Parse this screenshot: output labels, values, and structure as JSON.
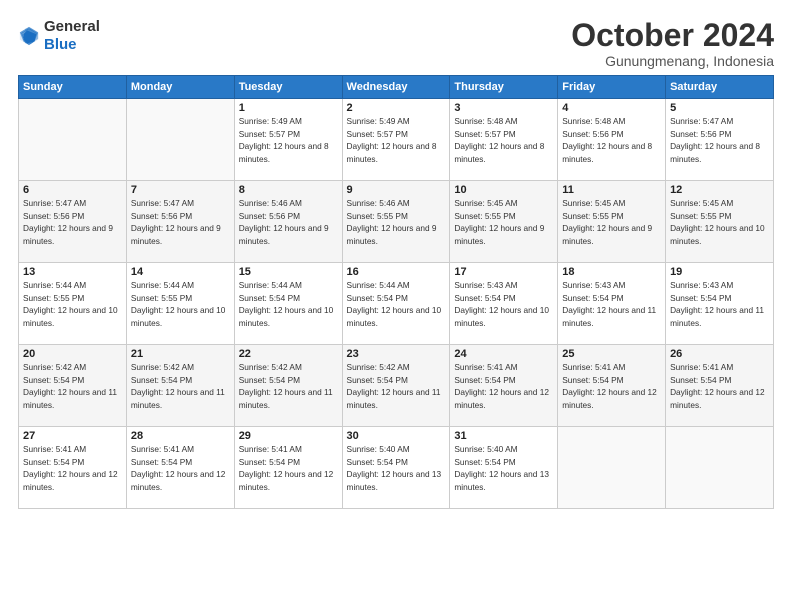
{
  "logo": {
    "general": "General",
    "blue": "Blue"
  },
  "title": "October 2024",
  "location": "Gunungmenang, Indonesia",
  "weekdays": [
    "Sunday",
    "Monday",
    "Tuesday",
    "Wednesday",
    "Thursday",
    "Friday",
    "Saturday"
  ],
  "days": [
    {
      "date": "",
      "info": ""
    },
    {
      "date": "",
      "info": ""
    },
    {
      "date": "1",
      "sunrise": "Sunrise: 5:49 AM",
      "sunset": "Sunset: 5:57 PM",
      "daylight": "Daylight: 12 hours and 8 minutes."
    },
    {
      "date": "2",
      "sunrise": "Sunrise: 5:49 AM",
      "sunset": "Sunset: 5:57 PM",
      "daylight": "Daylight: 12 hours and 8 minutes."
    },
    {
      "date": "3",
      "sunrise": "Sunrise: 5:48 AM",
      "sunset": "Sunset: 5:57 PM",
      "daylight": "Daylight: 12 hours and 8 minutes."
    },
    {
      "date": "4",
      "sunrise": "Sunrise: 5:48 AM",
      "sunset": "Sunset: 5:56 PM",
      "daylight": "Daylight: 12 hours and 8 minutes."
    },
    {
      "date": "5",
      "sunrise": "Sunrise: 5:47 AM",
      "sunset": "Sunset: 5:56 PM",
      "daylight": "Daylight: 12 hours and 8 minutes."
    },
    {
      "date": "6",
      "sunrise": "Sunrise: 5:47 AM",
      "sunset": "Sunset: 5:56 PM",
      "daylight": "Daylight: 12 hours and 9 minutes."
    },
    {
      "date": "7",
      "sunrise": "Sunrise: 5:47 AM",
      "sunset": "Sunset: 5:56 PM",
      "daylight": "Daylight: 12 hours and 9 minutes."
    },
    {
      "date": "8",
      "sunrise": "Sunrise: 5:46 AM",
      "sunset": "Sunset: 5:56 PM",
      "daylight": "Daylight: 12 hours and 9 minutes."
    },
    {
      "date": "9",
      "sunrise": "Sunrise: 5:46 AM",
      "sunset": "Sunset: 5:55 PM",
      "daylight": "Daylight: 12 hours and 9 minutes."
    },
    {
      "date": "10",
      "sunrise": "Sunrise: 5:45 AM",
      "sunset": "Sunset: 5:55 PM",
      "daylight": "Daylight: 12 hours and 9 minutes."
    },
    {
      "date": "11",
      "sunrise": "Sunrise: 5:45 AM",
      "sunset": "Sunset: 5:55 PM",
      "daylight": "Daylight: 12 hours and 9 minutes."
    },
    {
      "date": "12",
      "sunrise": "Sunrise: 5:45 AM",
      "sunset": "Sunset: 5:55 PM",
      "daylight": "Daylight: 12 hours and 10 minutes."
    },
    {
      "date": "13",
      "sunrise": "Sunrise: 5:44 AM",
      "sunset": "Sunset: 5:55 PM",
      "daylight": "Daylight: 12 hours and 10 minutes."
    },
    {
      "date": "14",
      "sunrise": "Sunrise: 5:44 AM",
      "sunset": "Sunset: 5:55 PM",
      "daylight": "Daylight: 12 hours and 10 minutes."
    },
    {
      "date": "15",
      "sunrise": "Sunrise: 5:44 AM",
      "sunset": "Sunset: 5:54 PM",
      "daylight": "Daylight: 12 hours and 10 minutes."
    },
    {
      "date": "16",
      "sunrise": "Sunrise: 5:44 AM",
      "sunset": "Sunset: 5:54 PM",
      "daylight": "Daylight: 12 hours and 10 minutes."
    },
    {
      "date": "17",
      "sunrise": "Sunrise: 5:43 AM",
      "sunset": "Sunset: 5:54 PM",
      "daylight": "Daylight: 12 hours and 10 minutes."
    },
    {
      "date": "18",
      "sunrise": "Sunrise: 5:43 AM",
      "sunset": "Sunset: 5:54 PM",
      "daylight": "Daylight: 12 hours and 11 minutes."
    },
    {
      "date": "19",
      "sunrise": "Sunrise: 5:43 AM",
      "sunset": "Sunset: 5:54 PM",
      "daylight": "Daylight: 12 hours and 11 minutes."
    },
    {
      "date": "20",
      "sunrise": "Sunrise: 5:42 AM",
      "sunset": "Sunset: 5:54 PM",
      "daylight": "Daylight: 12 hours and 11 minutes."
    },
    {
      "date": "21",
      "sunrise": "Sunrise: 5:42 AM",
      "sunset": "Sunset: 5:54 PM",
      "daylight": "Daylight: 12 hours and 11 minutes."
    },
    {
      "date": "22",
      "sunrise": "Sunrise: 5:42 AM",
      "sunset": "Sunset: 5:54 PM",
      "daylight": "Daylight: 12 hours and 11 minutes."
    },
    {
      "date": "23",
      "sunrise": "Sunrise: 5:42 AM",
      "sunset": "Sunset: 5:54 PM",
      "daylight": "Daylight: 12 hours and 11 minutes."
    },
    {
      "date": "24",
      "sunrise": "Sunrise: 5:41 AM",
      "sunset": "Sunset: 5:54 PM",
      "daylight": "Daylight: 12 hours and 12 minutes."
    },
    {
      "date": "25",
      "sunrise": "Sunrise: 5:41 AM",
      "sunset": "Sunset: 5:54 PM",
      "daylight": "Daylight: 12 hours and 12 minutes."
    },
    {
      "date": "26",
      "sunrise": "Sunrise: 5:41 AM",
      "sunset": "Sunset: 5:54 PM",
      "daylight": "Daylight: 12 hours and 12 minutes."
    },
    {
      "date": "27",
      "sunrise": "Sunrise: 5:41 AM",
      "sunset": "Sunset: 5:54 PM",
      "daylight": "Daylight: 12 hours and 12 minutes."
    },
    {
      "date": "28",
      "sunrise": "Sunrise: 5:41 AM",
      "sunset": "Sunset: 5:54 PM",
      "daylight": "Daylight: 12 hours and 12 minutes."
    },
    {
      "date": "29",
      "sunrise": "Sunrise: 5:41 AM",
      "sunset": "Sunset: 5:54 PM",
      "daylight": "Daylight: 12 hours and 12 minutes."
    },
    {
      "date": "30",
      "sunrise": "Sunrise: 5:40 AM",
      "sunset": "Sunset: 5:54 PM",
      "daylight": "Daylight: 12 hours and 13 minutes."
    },
    {
      "date": "31",
      "sunrise": "Sunrise: 5:40 AM",
      "sunset": "Sunset: 5:54 PM",
      "daylight": "Daylight: 12 hours and 13 minutes."
    },
    {
      "date": "",
      "info": ""
    },
    {
      "date": "",
      "info": ""
    },
    {
      "date": "",
      "info": ""
    }
  ]
}
